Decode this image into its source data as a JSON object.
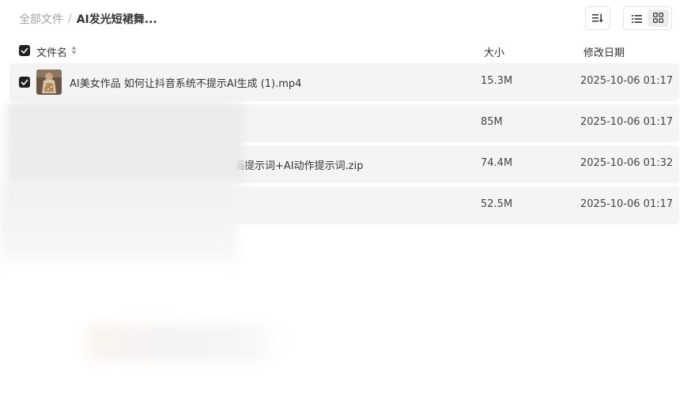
{
  "breadcrumb": {
    "root": "全部文件",
    "separator": "/",
    "current": "AI发光短裙舞..."
  },
  "toolbar": {
    "sort_icon": "sort-icon",
    "list_view_icon": "list-view-icon",
    "grid_view_icon": "grid-view-icon"
  },
  "table": {
    "headers": {
      "name": "文件名",
      "size": "大小",
      "date": "修改日期"
    },
    "rows": [
      {
        "name": "AI美女作品 如何让抖音系统不提示AI生成 (1).mp4",
        "size": "15.3M",
        "date": "2025-10-06 01:17",
        "checked": true
      },
      {
        "name": "",
        "size": "85M",
        "date": "2025-10-06 01:17",
        "checked": false
      },
      {
        "name": "画提示词+AI动作提示词.zip",
        "size": "74.4M",
        "date": "2025-10-06 01:32",
        "checked": false
      },
      {
        "name": "",
        "size": "52.5M",
        "date": "2025-10-06 01:17",
        "checked": false
      }
    ]
  },
  "colors": {
    "row_background": "#f4f4f5",
    "checkbox": "#1f1f1f",
    "text": "#333333"
  }
}
